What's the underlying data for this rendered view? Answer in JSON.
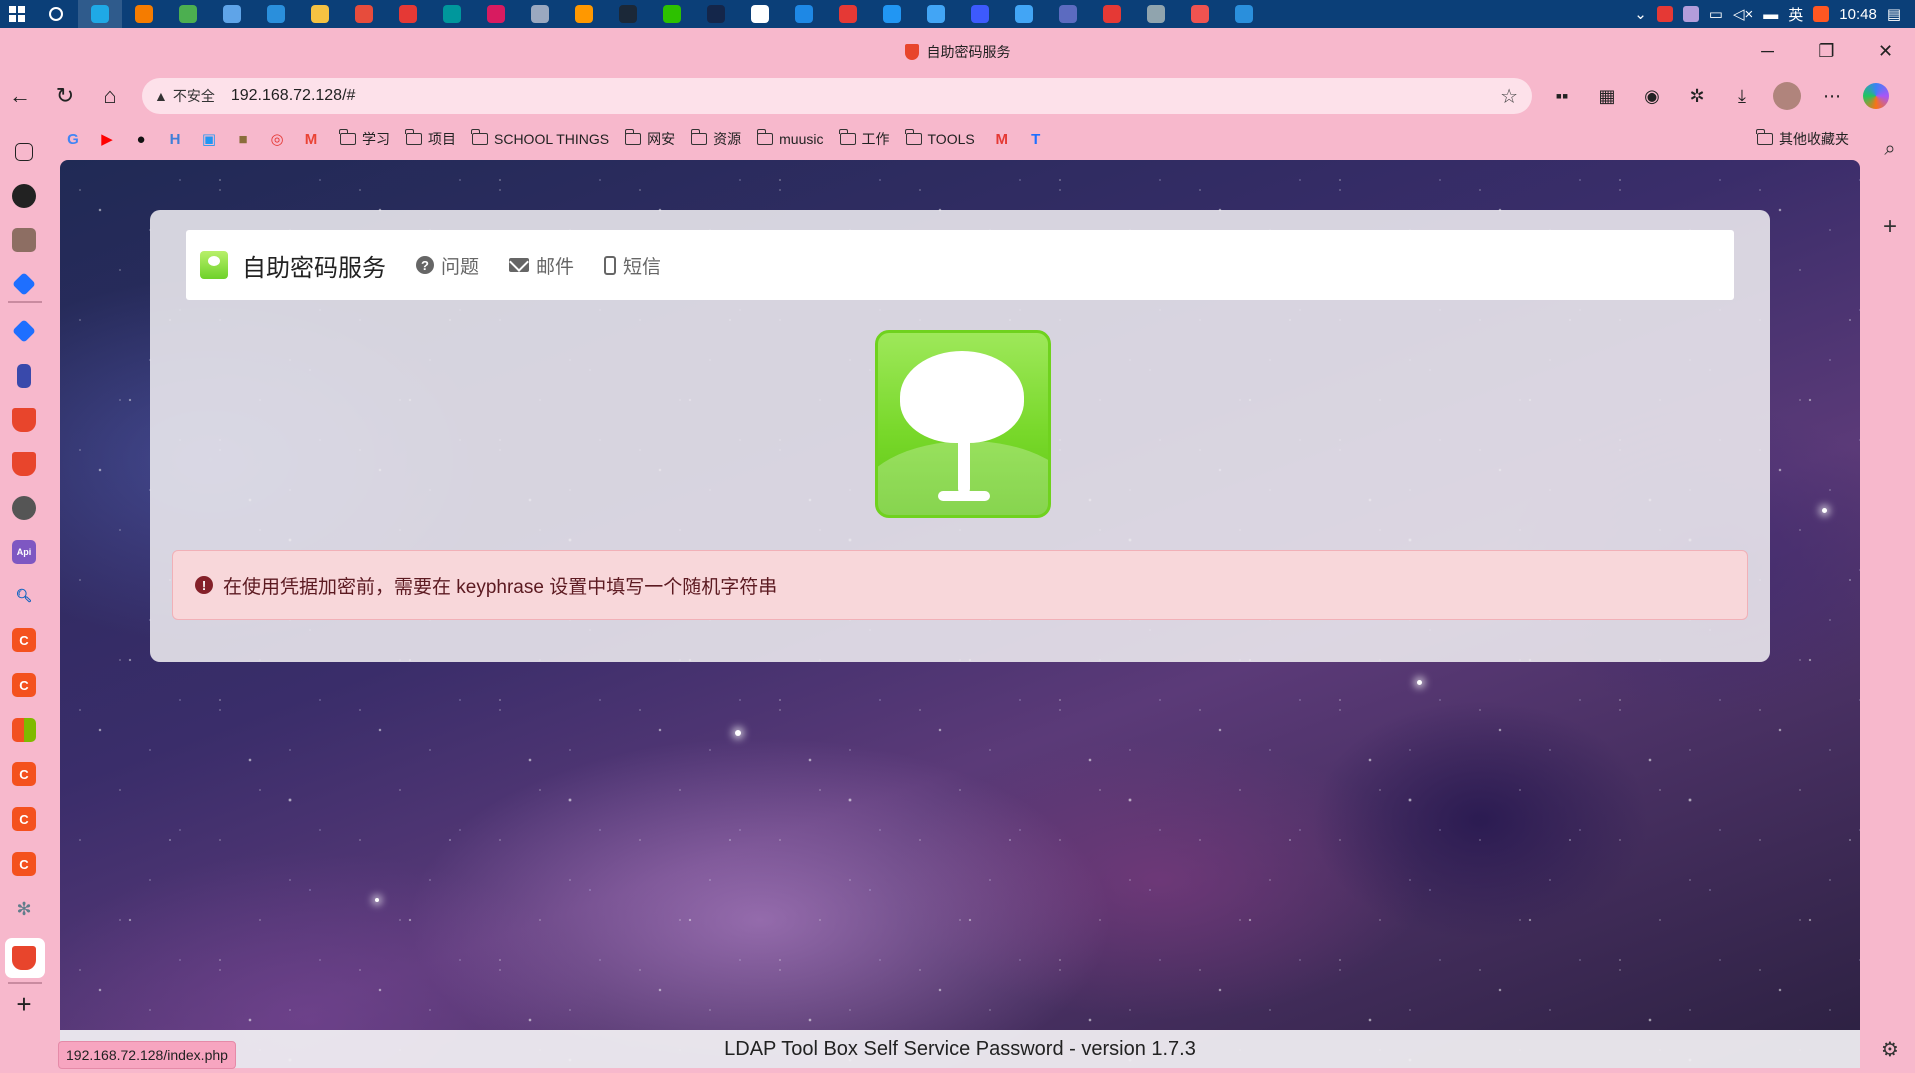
{
  "taskbar": {
    "time": "10:48",
    "ime": "英",
    "apps": [
      {
        "name": "search",
        "color": "#ffffff"
      },
      {
        "name": "edge",
        "color": "#1fa9e6"
      },
      {
        "name": "everything",
        "color": "#f57c00"
      },
      {
        "name": "chrome",
        "color": "#4caf50"
      },
      {
        "name": "app-blue",
        "color": "#5fa4e8"
      },
      {
        "name": "vscode",
        "color": "#2a8fdc"
      },
      {
        "name": "explorer",
        "color": "#f5c242"
      },
      {
        "name": "wps",
        "color": "#e74c3c"
      },
      {
        "name": "xmind",
        "color": "#e53935"
      },
      {
        "name": "arduino",
        "color": "#00979c"
      },
      {
        "name": "jetbrains",
        "color": "#d81b60"
      },
      {
        "name": "app-gray",
        "color": "#9aa8c0"
      },
      {
        "name": "app-orange",
        "color": "#ff9800"
      },
      {
        "name": "steam",
        "color": "#1b2838"
      },
      {
        "name": "wechat",
        "color": "#2dc100"
      },
      {
        "name": "app-dark",
        "color": "#14264a"
      },
      {
        "name": "typora",
        "color": "#ffffff"
      },
      {
        "name": "app-v",
        "color": "#1e88e5"
      },
      {
        "name": "netease-music",
        "color": "#e53935"
      },
      {
        "name": "app-b",
        "color": "#2196f3"
      },
      {
        "name": "app-bird",
        "color": "#42a5f5"
      },
      {
        "name": "app-circle",
        "color": "#3d5afe"
      },
      {
        "name": "app-bird2",
        "color": "#42a5f5"
      },
      {
        "name": "app-mon",
        "color": "#5c6bc0"
      },
      {
        "name": "app-red",
        "color": "#e53935"
      },
      {
        "name": "app-tile",
        "color": "#90a4ae"
      },
      {
        "name": "app-swirl",
        "color": "#ef5350"
      },
      {
        "name": "vscode2",
        "color": "#2a8fdc"
      }
    ]
  },
  "browser": {
    "tab_title": "自助密码服务",
    "security_label": "不安全",
    "url": "192.168.72.128/#",
    "status_url": "192.168.72.128/index.php",
    "other_bookmarks": "其他收藏夹",
    "bookmark_icons": [
      {
        "name": "google",
        "glyph": "G",
        "color": "#4285f4"
      },
      {
        "name": "youtube",
        "glyph": "▶",
        "color": "#ff0000"
      },
      {
        "name": "github",
        "glyph": "●",
        "color": "#111111"
      },
      {
        "name": "app-h",
        "glyph": "H",
        "color": "#3f7fd8"
      },
      {
        "name": "bilibili",
        "glyph": "▣",
        "color": "#2196f3"
      },
      {
        "name": "app-pic",
        "glyph": "■",
        "color": "#8a6d3b"
      },
      {
        "name": "app-ring",
        "glyph": "◎",
        "color": "#e53935"
      },
      {
        "name": "gmail",
        "glyph": "M",
        "color": "#ea4335"
      }
    ],
    "bookmark_folders": [
      "学习",
      "项目",
      "SCHOOL THINGS",
      "网安",
      "资源",
      "muusic",
      "工作",
      "TOOLS"
    ],
    "bookmark_icons_after": [
      {
        "name": "app-m",
        "glyph": "M",
        "color": "#e53935"
      },
      {
        "name": "app-translate",
        "glyph": "T",
        "color": "#1e6fff"
      }
    ]
  },
  "page": {
    "brand": "自助密码服务",
    "nav": {
      "question": "问题",
      "mail": "邮件",
      "sms": "短信"
    },
    "alert_icon": "!",
    "alert": "在使用凭据加密前，需要在 keyphrase 设置中填写一个随机字符串",
    "footer": "LDAP Tool Box Self Service Password - version 1.7.3"
  }
}
